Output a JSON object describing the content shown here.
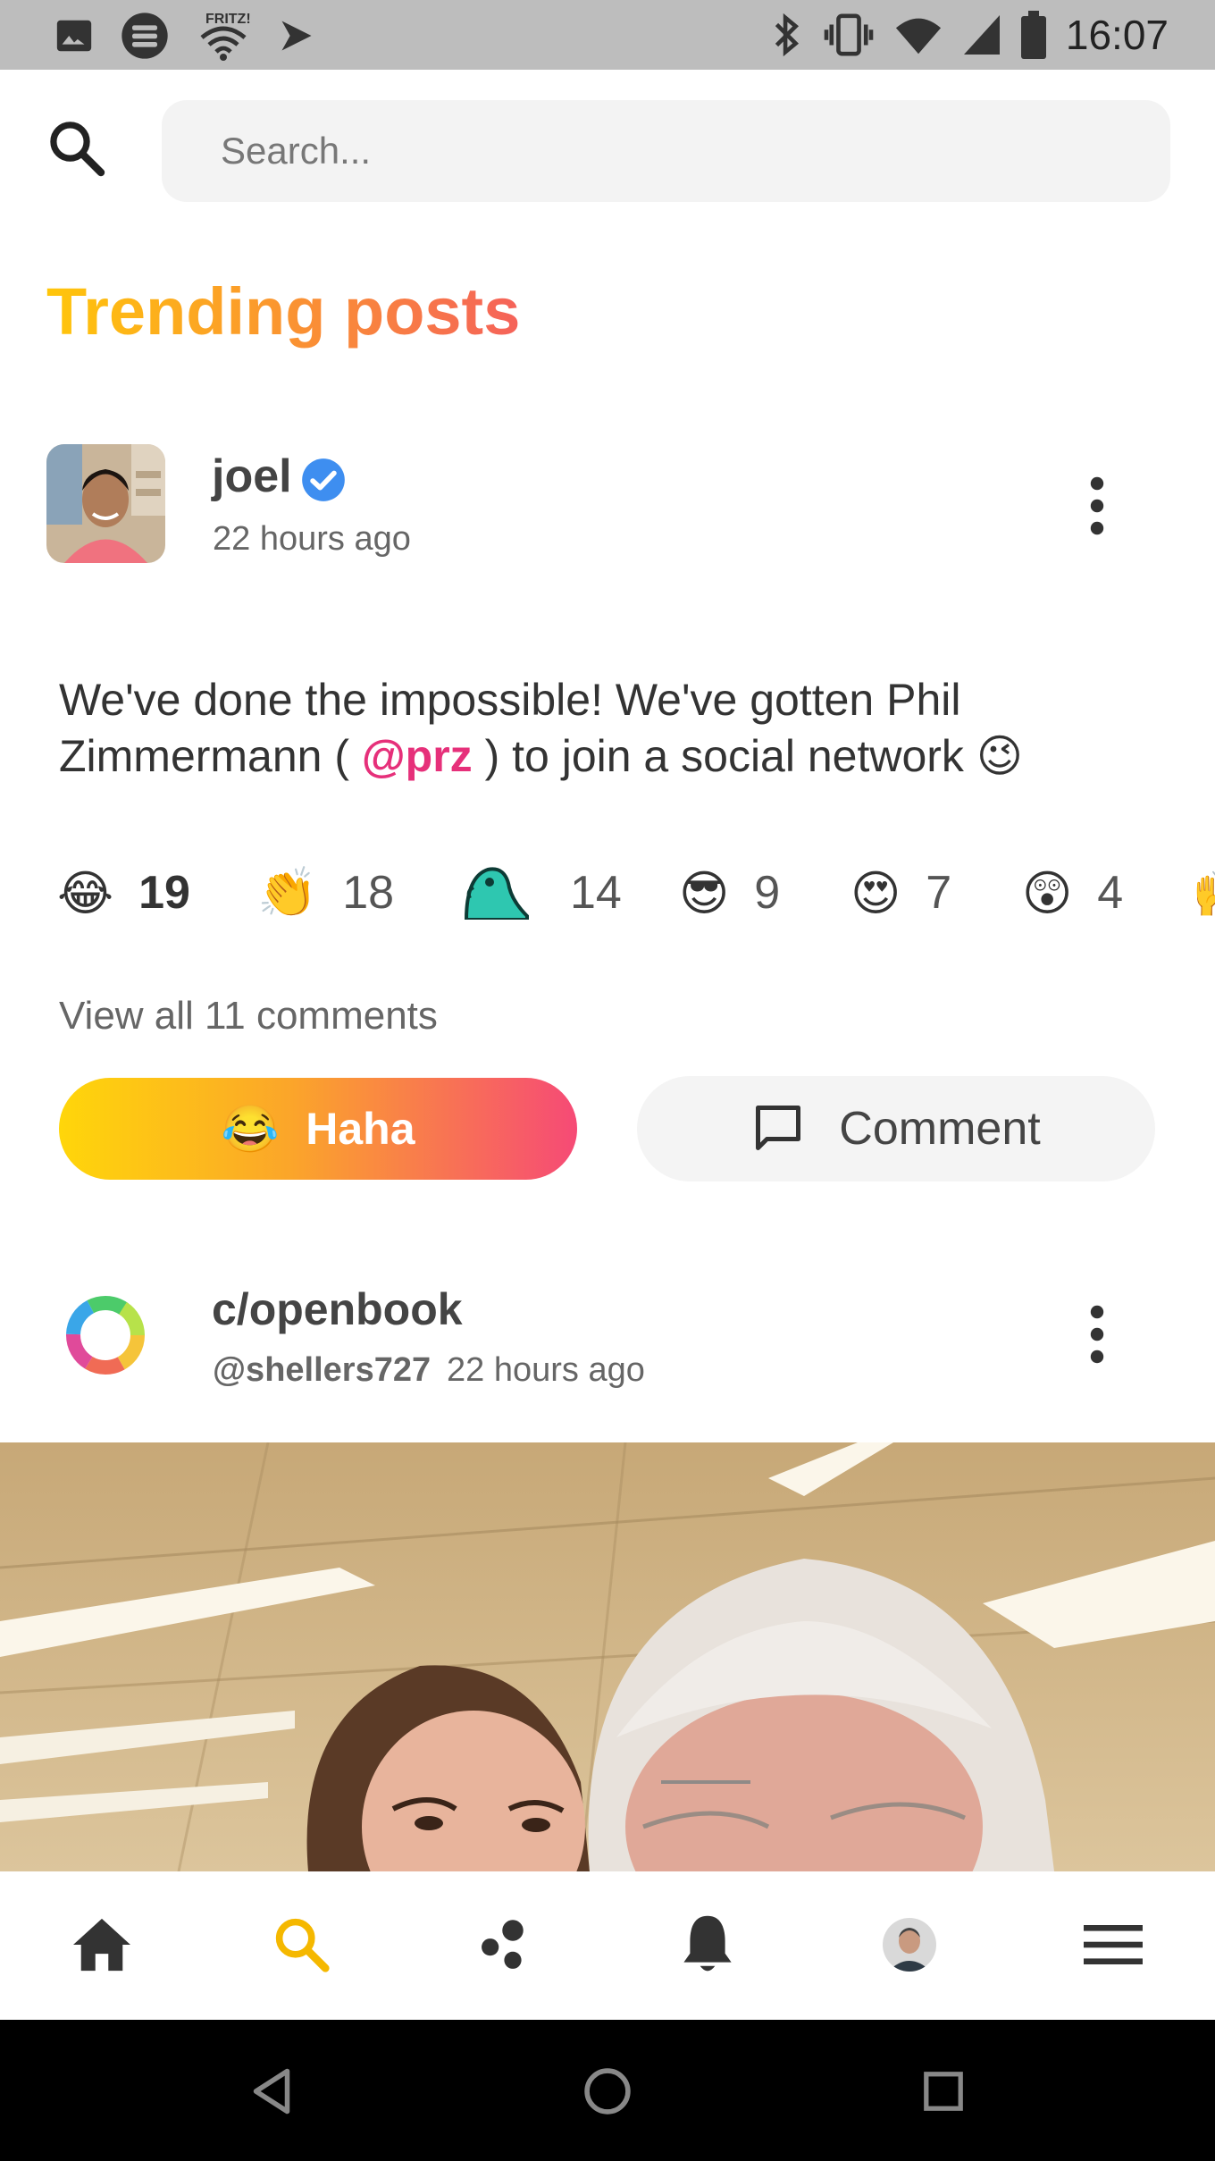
{
  "status_bar": {
    "time": "16:07",
    "left_icons": [
      "image-icon",
      "storage-icon",
      "fritz-wifi-icon",
      "play-icon"
    ],
    "right_icons": [
      "bluetooth-icon",
      "vibrate-icon",
      "wifi-icon",
      "signal-icon",
      "battery-icon"
    ]
  },
  "search": {
    "placeholder": "Search..."
  },
  "section": {
    "title": "Trending posts"
  },
  "post1": {
    "author": "joel",
    "verified": true,
    "time": "22 hours ago",
    "text_before": "We've done the impossible! We've gotten Phil Zimmermann ( ",
    "mention": "@prz",
    "text_after": " ) to join a social network",
    "text_emoji": "😉",
    "reactions": [
      {
        "emoji": "😂",
        "count": "19",
        "bold": true
      },
      {
        "emoji": "👏",
        "count": "18",
        "bold": false
      },
      {
        "emoji": "party-parrot-icon",
        "count": "14",
        "bold": false
      },
      {
        "emoji": "😎",
        "count": "9",
        "bold": false
      },
      {
        "emoji": "😍",
        "count": "7",
        "bold": false
      },
      {
        "emoji": "😲",
        "count": "4",
        "bold": false
      },
      {
        "emoji": "🙌",
        "count": "",
        "bold": false
      }
    ],
    "view_comments": "View all 11 comments",
    "react_button": {
      "emoji": "😂",
      "label": "Haha"
    },
    "comment_button": {
      "label": "Comment"
    }
  },
  "post2": {
    "community": "c/openbook",
    "username": "@shellers727",
    "time": "22 hours ago"
  },
  "bottom_nav": [
    "home-icon",
    "search-icon",
    "communities-icon",
    "notifications-icon",
    "profile-avatar",
    "menu-icon"
  ],
  "colors": {
    "accent_yellow": "#ffc60a",
    "accent_pink": "#f64a76",
    "active_nav": "#f5b800",
    "mention": "#e6307a"
  }
}
